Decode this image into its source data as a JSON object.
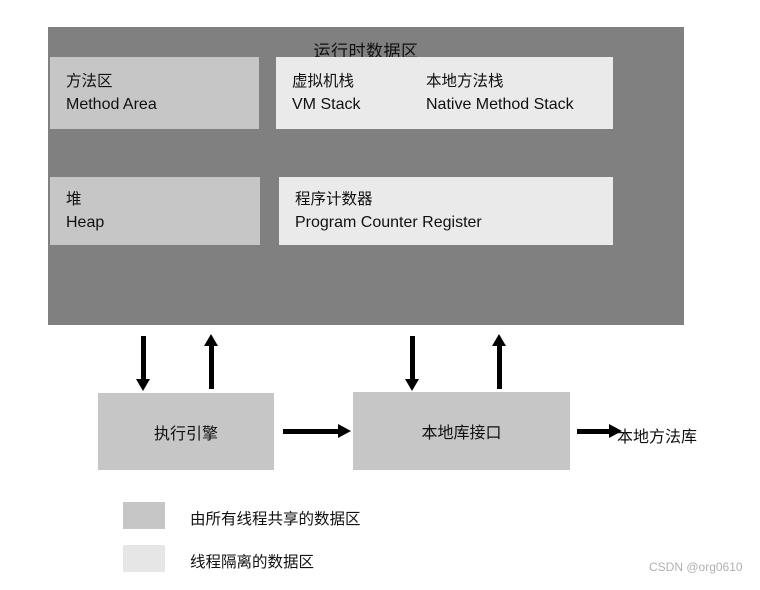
{
  "diagram": {
    "title": "运行时数据区",
    "runtime_area": {
      "boxes": [
        {
          "cn": "方法区",
          "en": "Method Area",
          "type": "shared"
        },
        {
          "cn": "虚拟机栈",
          "en": "VM Stack",
          "type": "isolated"
        },
        {
          "cn": "本地方法栈",
          "en": "Native Method Stack",
          "type": "isolated"
        },
        {
          "cn": "堆",
          "en": "Heap",
          "type": "shared"
        },
        {
          "cn": "程序计数器",
          "en": "Program Counter Register",
          "type": "isolated"
        }
      ]
    },
    "lower": {
      "execution_engine": "执行引擎",
      "native_interface": "本地库接口",
      "native_library": "本地方法库"
    },
    "legend": [
      {
        "label": "由所有线程共享的数据区",
        "color": "#c6c6c6"
      },
      {
        "label": "线程隔离的数据区",
        "color": "#e6e6e6"
      }
    ],
    "watermark": "CSDN @org0610",
    "colors": {
      "container": "#808080",
      "shared": "#c6c6c6",
      "isolated": "#eaeaea",
      "arrow": "#000000",
      "background": "#ffffff"
    }
  }
}
